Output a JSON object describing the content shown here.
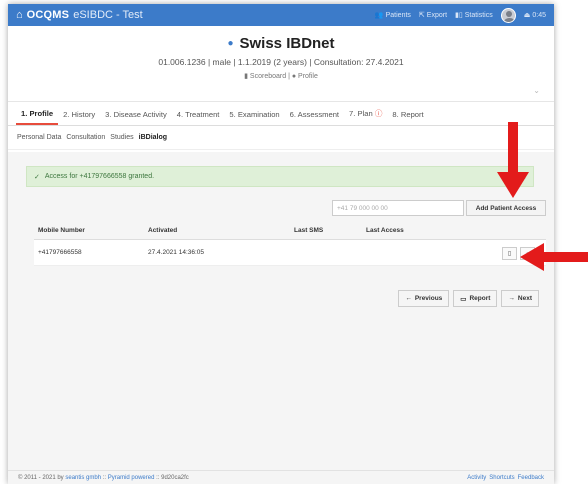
{
  "navbar": {
    "brand_name": "OCQMS",
    "brand_sub": "eSIBDC - Test",
    "patients": "Patients",
    "export": "Export",
    "statistics": "Statistics",
    "timer": "0:45"
  },
  "header": {
    "title": "Swiss IBDnet",
    "info": "01.006.1236 | male | 1.1.2019 (2 years) | Consultation: 27.4.2021",
    "scoreboard": "Scoreboard",
    "profile": "Profile"
  },
  "tabs": [
    {
      "label": "1. Profile"
    },
    {
      "label": "2. History"
    },
    {
      "label": "3. Disease Activity"
    },
    {
      "label": "4. Treatment"
    },
    {
      "label": "5. Examination"
    },
    {
      "label": "6. Assessment"
    },
    {
      "label": "7. Plan"
    },
    {
      "label": "8. Report"
    }
  ],
  "subtabs": [
    "Personal Data",
    "Consultation",
    "Studies",
    "iBDialog"
  ],
  "alert": {
    "message": "Access for +41797666558 granted."
  },
  "access_form": {
    "placeholder": "+41 79 000 00 00",
    "add_label": "Add Patient Access"
  },
  "table": {
    "headers": [
      "Mobile Number",
      "Activated",
      "Last SMS",
      "Last Access"
    ],
    "rows": [
      {
        "mobile": "+41797666558",
        "activated": "27.4.2021 14:36:05",
        "last_sms": "",
        "last_access": ""
      }
    ]
  },
  "nav_buttons": {
    "previous": "Previous",
    "report": "Report",
    "next": "Next"
  },
  "footer": {
    "copyright": "© 2011 - 2021 by",
    "company": "seantis gmbh",
    "sep1": "::",
    "pyramid": "Pyramid powered",
    "sep2": "::",
    "hash": "9d20ca2fc",
    "activity": "Activity",
    "shortcuts": "Shortcuts",
    "feedback": "Feedback"
  },
  "colors": {
    "navbar": "#3c7bc9",
    "accent_red": "#e31b1b",
    "success_bg": "#dff0d8"
  }
}
